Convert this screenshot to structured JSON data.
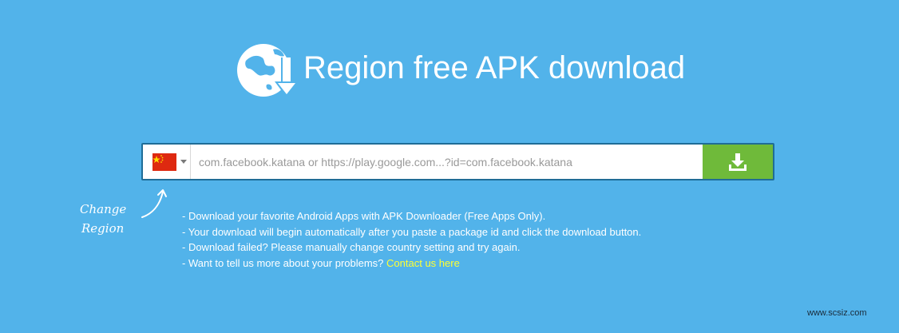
{
  "header": {
    "title": "Region free APK download",
    "logo_icon": "globe-download-icon"
  },
  "search": {
    "region_flag": "china-flag-icon",
    "placeholder": "com.facebook.katana or https://play.google.com...?id=com.facebook.katana",
    "value": "",
    "download_icon": "download-icon"
  },
  "annotation": {
    "line1": "Change",
    "line2": "Region"
  },
  "info": {
    "line1": "- Download your favorite Android Apps with APK Downloader (Free Apps Only).",
    "line2": "- Your download will begin automatically after you paste a package id and click the download button.",
    "line3": "- Download failed? Please manually change country setting and try again.",
    "line4_prefix": "- Want to tell us more about your problems? ",
    "line4_link": "Contact us here"
  },
  "watermark": "www.scsiz.com",
  "colors": {
    "background": "#52b3ea",
    "button": "#6fba3a",
    "link": "#ffff33",
    "flag_red": "#de2910",
    "flag_star": "#ffde00"
  }
}
